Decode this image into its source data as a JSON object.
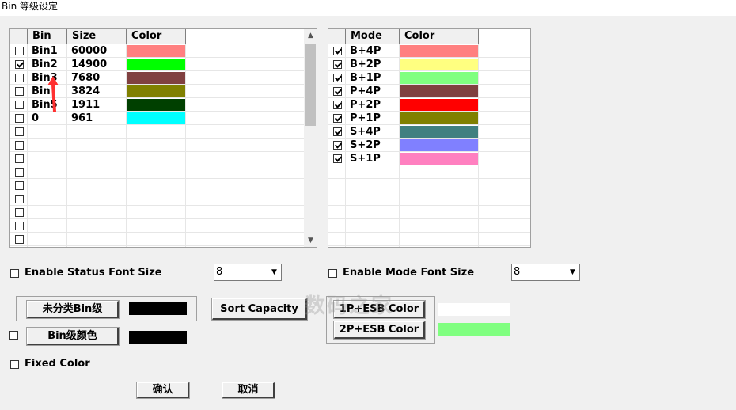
{
  "window": {
    "title": "Bin 等级设定"
  },
  "bin_table": {
    "headers": [
      "Bin",
      "Size",
      "Color"
    ],
    "rows": [
      {
        "checked": false,
        "bin": "Bin1",
        "size": "60000",
        "color": "#ff8080"
      },
      {
        "checked": true,
        "bin": "Bin2",
        "size": "14900",
        "color": "#00ff00"
      },
      {
        "checked": false,
        "bin": "Bin3",
        "size": "7680",
        "color": "#804040"
      },
      {
        "checked": false,
        "bin": "Bin",
        "size": "3824",
        "color": "#808000"
      },
      {
        "checked": false,
        "bin": "Bin5",
        "size": "1911",
        "color": "#004000"
      },
      {
        "checked": false,
        "bin": "0",
        "size": "961",
        "color": "#00ffff"
      }
    ],
    "empty_rows": 9
  },
  "mode_table": {
    "headers": [
      "Mode",
      "Color"
    ],
    "rows": [
      {
        "checked": true,
        "mode": "B+4P",
        "color": "#ff8080"
      },
      {
        "checked": true,
        "mode": "B+2P",
        "color": "#ffff80"
      },
      {
        "checked": true,
        "mode": "B+1P",
        "color": "#80ff80"
      },
      {
        "checked": true,
        "mode": "P+4P",
        "color": "#804040"
      },
      {
        "checked": true,
        "mode": "P+2P",
        "color": "#ff0000"
      },
      {
        "checked": true,
        "mode": "P+1P",
        "color": "#808000"
      },
      {
        "checked": true,
        "mode": "S+4P",
        "color": "#408080"
      },
      {
        "checked": true,
        "mode": "S+2P",
        "color": "#8080ff"
      },
      {
        "checked": true,
        "mode": "S+1P",
        "color": "#ff80c0"
      }
    ]
  },
  "status_font": {
    "label": "Enable Status Font Size",
    "checked": false,
    "value": "8"
  },
  "mode_font": {
    "label": "Enable Mode Font Size",
    "checked": false,
    "value": "8"
  },
  "unclassified_button": {
    "label": "未分类Bin级",
    "color": "#000000"
  },
  "bin_color": {
    "label": "Bin级颜色",
    "checked": false,
    "color": "#000000"
  },
  "sort_capacity_button": {
    "label": "Sort Capacity"
  },
  "esb1_button": {
    "label": "1P+ESB Color",
    "color": "#ffffff"
  },
  "esb2_button": {
    "label": "2P+ESB Color",
    "color": "#80ff80"
  },
  "fixed_color": {
    "label": "Fixed Color",
    "checked": false
  },
  "ok_button": {
    "label": "确认"
  },
  "cancel_button": {
    "label": "取消"
  },
  "watermark": {
    "text": "数码之家"
  },
  "icons": {
    "dropdown": "chevron-down-icon",
    "cursor": "red-arrow-pointer-icon"
  }
}
